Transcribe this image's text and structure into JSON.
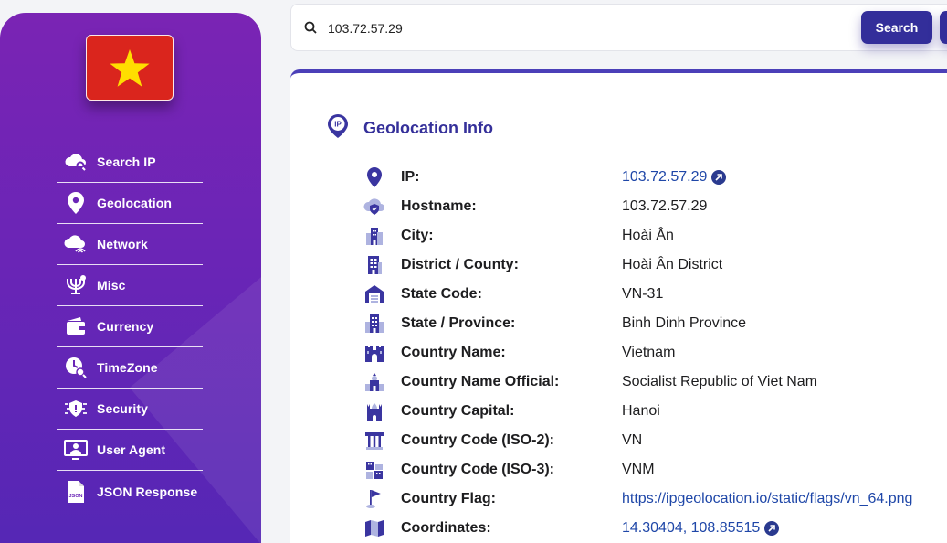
{
  "country_flag": {
    "country": "Vietnam",
    "bg_color": "#da251d",
    "star_color": "#ffde00"
  },
  "sidebar": {
    "items": [
      {
        "label": "Search IP",
        "icon": "cloud-search-icon"
      },
      {
        "label": "Geolocation",
        "icon": "map-pin-icon"
      },
      {
        "label": "Network",
        "icon": "cloud-network-icon"
      },
      {
        "label": "Misc",
        "icon": "menorah-icon"
      },
      {
        "label": "Currency",
        "icon": "wallet-icon"
      },
      {
        "label": "TimeZone",
        "icon": "clock-search-icon"
      },
      {
        "label": "Security",
        "icon": "virus-shield-icon"
      },
      {
        "label": "User Agent",
        "icon": "monitor-user-icon"
      },
      {
        "label": "JSON Response",
        "icon": "json-file-icon"
      }
    ]
  },
  "search": {
    "value": "103.72.57.29",
    "button_label": "Search"
  },
  "geolocation": {
    "title": "Geolocation Info",
    "rows": [
      {
        "label": "IP:",
        "value": "103.72.57.29",
        "link": true,
        "external": true
      },
      {
        "label": "Hostname:",
        "value": "103.72.57.29"
      },
      {
        "label": "City:",
        "value": "Hoài Ân"
      },
      {
        "label": "District / County:",
        "value": "Hoài Ân District"
      },
      {
        "label": "State Code:",
        "value": "VN-31"
      },
      {
        "label": "State / Province:",
        "value": "Binh Dinh Province"
      },
      {
        "label": "Country Name:",
        "value": "Vietnam"
      },
      {
        "label": "Country Name Official:",
        "value": "Socialist Republic of Viet Nam"
      },
      {
        "label": "Country Capital:",
        "value": "Hanoi"
      },
      {
        "label": "Country Code (ISO-2):",
        "value": "VN"
      },
      {
        "label": "Country Code (ISO-3):",
        "value": "VNM"
      },
      {
        "label": "Country Flag:",
        "value": "https://ipgeolocation.io/static/flags/vn_64.png",
        "link": true
      },
      {
        "label": "Coordinates:",
        "value": "14.30404, 108.85515",
        "link": true,
        "external": true
      }
    ]
  },
  "colors": {
    "accent": "#35309a",
    "link": "#1f47a8",
    "sidebar_top": "#7a24b4",
    "sidebar_bottom": "#5427b5"
  }
}
